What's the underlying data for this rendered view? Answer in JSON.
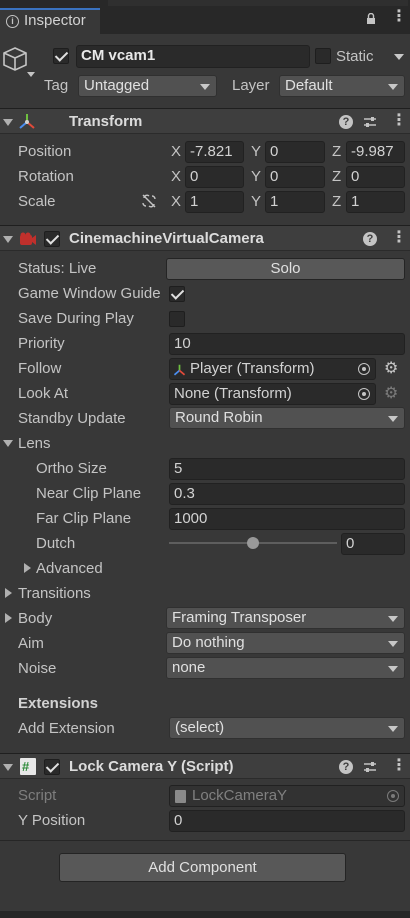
{
  "tab": {
    "title": "Inspector"
  },
  "gameobject": {
    "name": "CM vcam1",
    "static_label": "Static",
    "tag_label": "Tag",
    "tag_value": "Untagged",
    "layer_label": "Layer",
    "layer_value": "Default"
  },
  "transform": {
    "title": "Transform",
    "position_label": "Position",
    "rotation_label": "Rotation",
    "scale_label": "Scale",
    "axes": {
      "x": "X",
      "y": "Y",
      "z": "Z"
    },
    "position": {
      "x": "-7.821",
      "y": "0",
      "z": "-9.987"
    },
    "rotation": {
      "x": "0",
      "y": "0",
      "z": "0"
    },
    "scale": {
      "x": "1",
      "y": "1",
      "z": "1"
    }
  },
  "vcam": {
    "title": "CinemachineVirtualCamera",
    "status_label": "Status: Live",
    "solo_button": "Solo",
    "game_window_guides_label": "Game Window Guide",
    "save_during_play_label": "Save During Play",
    "priority_label": "Priority",
    "priority_value": "10",
    "follow_label": "Follow",
    "follow_value": "Player (Transform)",
    "look_at_label": "Look At",
    "look_at_value": "None (Transform)",
    "standby_label": "Standby Update",
    "standby_value": "Round Robin",
    "lens_label": "Lens",
    "ortho_label": "Ortho Size",
    "ortho_value": "5",
    "near_label": "Near Clip Plane",
    "near_value": "0.3",
    "far_label": "Far Clip Plane",
    "far_value": "1000",
    "dutch_label": "Dutch",
    "dutch_value": "0",
    "dutch_fraction": 0.5,
    "advanced_label": "Advanced",
    "transitions_label": "Transitions",
    "body_label": "Body",
    "body_value": "Framing Transposer",
    "aim_label": "Aim",
    "aim_value": "Do nothing",
    "noise_label": "Noise",
    "noise_value": "none",
    "extensions_label": "Extensions",
    "add_extension_label": "Add Extension",
    "add_extension_value": "(select)"
  },
  "lockcam": {
    "title": "Lock Camera Y (Script)",
    "script_label": "Script",
    "script_value": "LockCameraY",
    "ypos_label": "Y Position",
    "ypos_value": "0"
  },
  "add_component_button": "Add Component"
}
